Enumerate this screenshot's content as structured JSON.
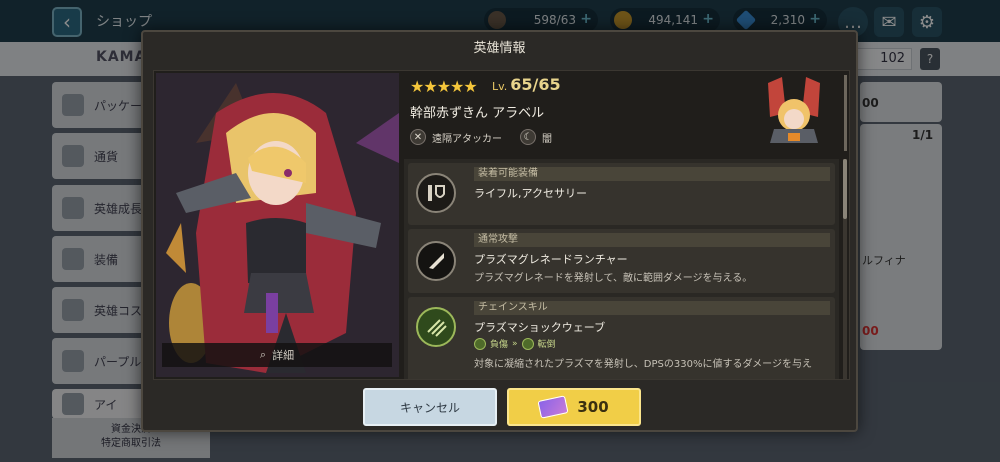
{
  "topbar": {
    "title": "ショップ",
    "stamina": "598/63",
    "gold": "494,141",
    "gems": "2,310"
  },
  "subbar": {
    "brand": "KAMAZ",
    "level": "102",
    "help": "?"
  },
  "sidebar": {
    "items": [
      {
        "label": "パッケー"
      },
      {
        "label": "通貨"
      },
      {
        "label": "英雄成長"
      },
      {
        "label": "装備"
      },
      {
        "label": "英雄コス"
      },
      {
        "label": "パープル"
      },
      {
        "label": "アイ"
      }
    ],
    "bottom_note_1": "資金決済",
    "bottom_note_2": "特定商取引法"
  },
  "right_panel": {
    "price_top": "00",
    "count": "1/1",
    "hero_name_partial": "ルフィナ",
    "price_red": "00"
  },
  "modal": {
    "title": "英雄情報",
    "stars": "★★★★★",
    "level_prefix": "Lv.",
    "level": "65/65",
    "hero_name": "幹部赤ずきん アラベル",
    "role": "遠隔アタッカー",
    "element": "闇",
    "detail_label": "詳細",
    "sections": [
      {
        "header": "装着可能装備",
        "title": "ライフル,アクセサリー",
        "desc": ""
      },
      {
        "header": "通常攻撃",
        "title": "プラズマグレネードランチャー",
        "desc": "プラズマグレネードを発射して、敵に範囲ダメージを与える。"
      },
      {
        "header": "チェインスキル",
        "title": "プラズマショックウェーブ",
        "tag_from": "負傷",
        "tag_to": "転倒",
        "desc": "対象に凝縮されたプラズマを発射し、DPSの330%に値するダメージを与え"
      }
    ],
    "cancel_label": "キャンセル",
    "price": "300"
  },
  "colors": {
    "accent_gold": "#f1ce47",
    "cancel_blue": "#c7d7e2",
    "star": "#f5c63b"
  }
}
